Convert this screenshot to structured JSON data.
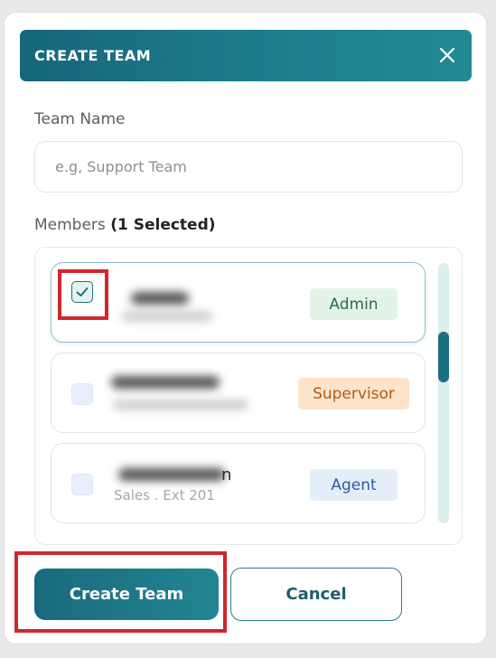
{
  "header": {
    "title": "CREATE TEAM",
    "close_icon": "close-icon"
  },
  "team_name": {
    "label": "Team Name",
    "placeholder": "e.g, Support Team",
    "value": ""
  },
  "members": {
    "label": "Members",
    "selected_count_text": "(1 Selected)",
    "items": [
      {
        "name": "",
        "subtitle": "",
        "role": "Admin",
        "checked": true,
        "role_color": "#2a6e45"
      },
      {
        "name": "",
        "subtitle": "",
        "role": "Supervisor",
        "checked": false,
        "role_color": "#b35a16"
      },
      {
        "name": "n",
        "subtitle": "Sales . Ext 201",
        "role": "Agent",
        "checked": false,
        "role_color": "#2f5a9a"
      }
    ]
  },
  "actions": {
    "create_label": "Create Team",
    "cancel_label": "Cancel"
  },
  "colors": {
    "accent": "#1c6f82",
    "highlight": "#d0262e"
  }
}
